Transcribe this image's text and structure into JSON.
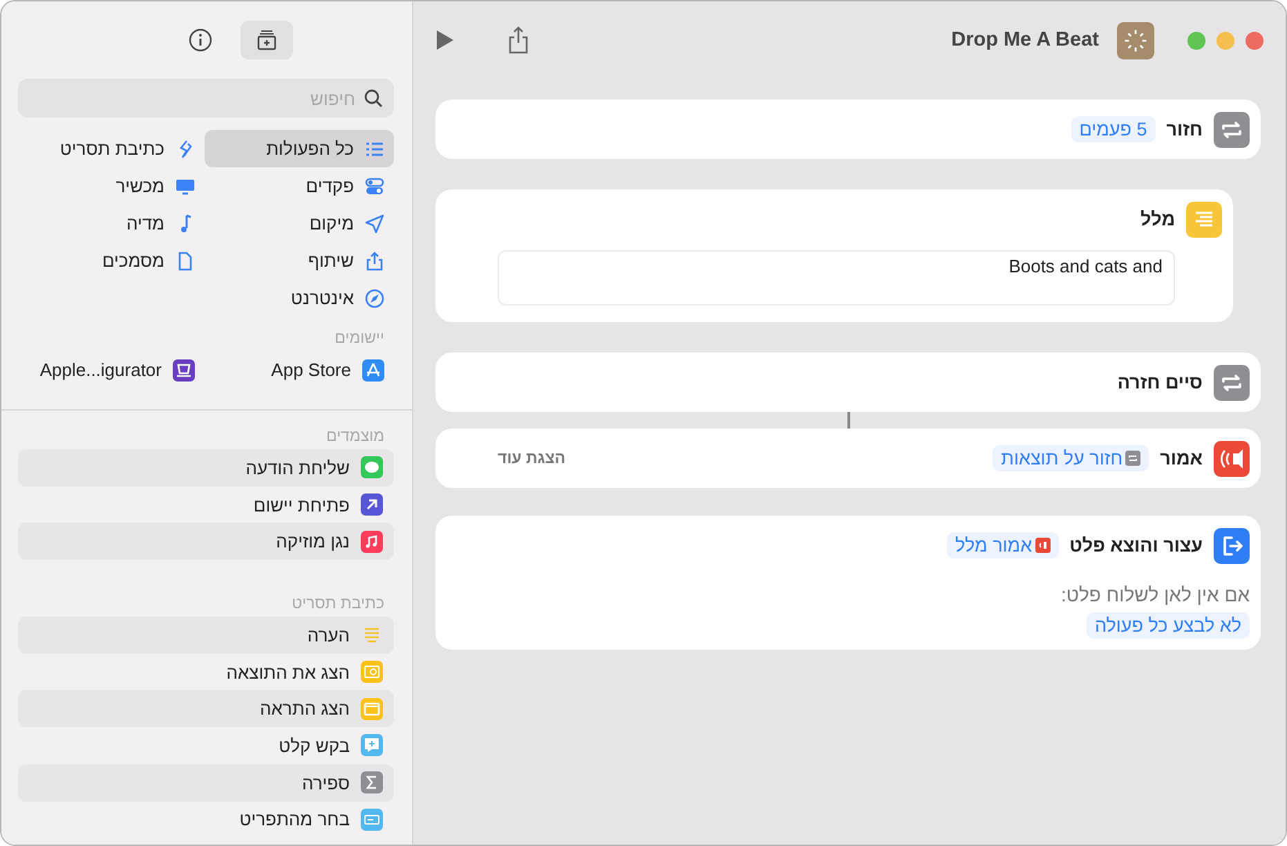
{
  "window": {
    "title": "Drop Me A Beat"
  },
  "sidebar": {
    "search": {
      "placeholder": "חיפוש"
    },
    "categories": [
      {
        "label": "כל הפעולות",
        "kind": "list",
        "selected": true
      },
      {
        "label": "כתיבת תסריט",
        "kind": "script",
        "selected": false
      },
      {
        "label": "פקדים",
        "kind": "toggles",
        "selected": false
      },
      {
        "label": "מכשיר",
        "kind": "display",
        "selected": false
      },
      {
        "label": "מיקום",
        "kind": "location",
        "selected": false
      },
      {
        "label": "מדיה",
        "kind": "music",
        "selected": false
      },
      {
        "label": "שיתוף",
        "kind": "share",
        "selected": false
      },
      {
        "label": "מסמכים",
        "kind": "document",
        "selected": false
      },
      {
        "label": "אינטרנט",
        "kind": "compass",
        "selected": false
      }
    ],
    "apps_header": "יישומים",
    "apps": [
      {
        "label": "App Store",
        "kind": "store"
      },
      {
        "label": "Apple...igurator",
        "kind": "configurator"
      }
    ],
    "pinned_header": "מוצמדים",
    "pinned": [
      {
        "label": "שליחת הודעה",
        "kind": "message"
      },
      {
        "label": "פתיחת יישום",
        "kind": "open"
      },
      {
        "label": "נגן מוזיקה",
        "kind": "play-music"
      }
    ],
    "scripting_header": "כתיבת תסריט",
    "scripting": [
      {
        "label": "הערה",
        "kind": "comment"
      },
      {
        "label": "הצג את התוצאה",
        "kind": "result"
      },
      {
        "label": "הצג התראה",
        "kind": "alert"
      },
      {
        "label": "בקש קלט",
        "kind": "input"
      },
      {
        "label": "ספירה",
        "kind": "count"
      },
      {
        "label": "בחר מהתפריט",
        "kind": "menu"
      }
    ]
  },
  "actions": [
    {
      "kind": "repeat",
      "title": "חזור",
      "token": "5 פעמים"
    },
    {
      "kind": "text",
      "title": "מלל",
      "value": "Boots and cats and"
    },
    {
      "kind": "end-repeat",
      "title": "סיים חזרה"
    },
    {
      "kind": "speak",
      "title": "אמור",
      "token": "חזור על תוצאות",
      "more": "הצגת עוד"
    },
    {
      "kind": "stop",
      "title": "עצור והוצא פלט",
      "token": "אמור מלל",
      "label": "אם אין לאן לשלוח פלט:",
      "option": "לא לבצע כל פעולה"
    }
  ]
}
